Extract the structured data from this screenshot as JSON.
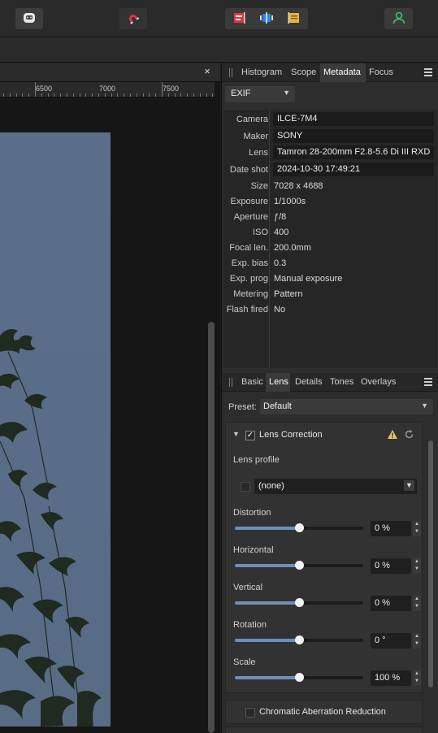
{
  "toolbar": {
    "persona_icon": "robot-face-icon",
    "snap_icon": "magnet-icon",
    "align_icons": [
      "align-left-icon",
      "align-center-icon",
      "align-right-icon"
    ],
    "user_icon": "user-icon",
    "colors": {
      "magnet": "#d93a3a",
      "align_red": "#e0383a",
      "align_blue": "#2a82e4",
      "align_yellow": "#e8b43a",
      "user": "#3cc36a"
    }
  },
  "document": {
    "close_glyph": "×"
  },
  "ruler": {
    "labels": [
      "6500",
      "7000",
      "7500"
    ]
  },
  "metadata_panel": {
    "tabs": [
      "Histogram",
      "Scope",
      "Metadata",
      "Focus"
    ],
    "active_tab": "Metadata",
    "exif_select": "EXIF",
    "rows": [
      {
        "label": "Camera",
        "value": "ILCE-7M4"
      },
      {
        "label": "Maker",
        "value": "SONY"
      },
      {
        "label": "Lens",
        "value": "Tamron 28-200mm F2.8-5.6 Di III RXD"
      },
      {
        "label": "Date shot",
        "value": "2024-10-30 17:49:21"
      },
      {
        "label": "Size",
        "value": "7028 x 4688"
      },
      {
        "label": "Exposure",
        "value": "1/1000s"
      },
      {
        "label": "Aperture",
        "value": "ƒ/8"
      },
      {
        "label": "ISO",
        "value": "400"
      },
      {
        "label": "Focal len.",
        "value": "200.0mm"
      },
      {
        "label": "Exp. bias",
        "value": "0.3"
      },
      {
        "label": "Exp. prog",
        "value": "Manual exposure"
      },
      {
        "label": "Metering",
        "value": "Pattern"
      },
      {
        "label": "Flash fired",
        "value": "No"
      }
    ]
  },
  "lens_panel": {
    "tabs": [
      "Basic",
      "Lens",
      "Details",
      "Tones",
      "Overlays"
    ],
    "active_tab": "Lens",
    "preset_label": "Preset:",
    "preset_value": "Default",
    "lens_correction": {
      "title": "Lens Correction",
      "enabled": true,
      "check_glyph": "✓",
      "profile_label": "Lens profile",
      "profile_value": "(none)"
    },
    "sliders": [
      {
        "label": "Distortion",
        "value": "0 %",
        "level": 0.5
      },
      {
        "label": "Horizontal",
        "value": "0 %",
        "level": 0.5
      },
      {
        "label": "Vertical",
        "value": "0 %",
        "level": 0.5
      },
      {
        "label": "Rotation",
        "value": "0 °",
        "level": 0.5
      },
      {
        "label": "Scale",
        "value": "100 %",
        "level": 0.5
      }
    ],
    "chromatic": {
      "title": "Chromatic Aberration Reduction",
      "enabled": false
    }
  }
}
